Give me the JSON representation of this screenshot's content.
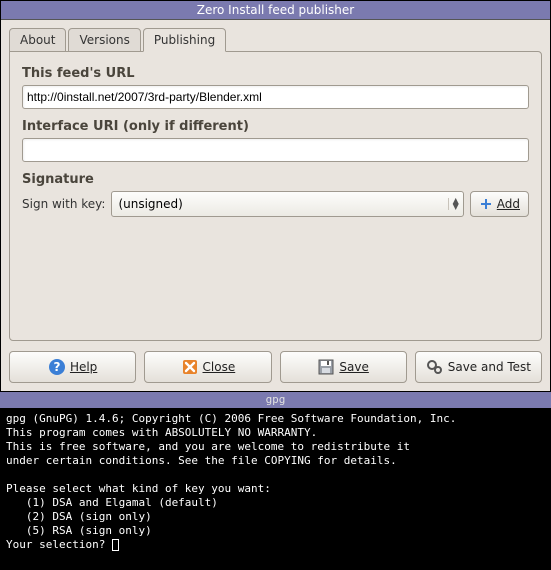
{
  "window": {
    "title": "Zero Install feed publisher"
  },
  "tabs": [
    {
      "label": "About"
    },
    {
      "label": "Versions"
    },
    {
      "label": "Publishing"
    }
  ],
  "feed_url": {
    "label": "This feed's URL",
    "value": "http://0install.net/2007/3rd-party/Blender.xml"
  },
  "interface_uri": {
    "label": "Interface URI (only if different)",
    "value": ""
  },
  "signature": {
    "label": "Signature",
    "sign_with_key_label": "Sign with key:",
    "selected": "(unsigned)",
    "add_label": "Add"
  },
  "buttons": {
    "help": "Help",
    "close": "Close",
    "save": "Save",
    "save_and_test": "Save and Test"
  },
  "terminal": {
    "title": "gpg",
    "lines": [
      "gpg (GnuPG) 1.4.6; Copyright (C) 2006 Free Software Foundation, Inc.",
      "This program comes with ABSOLUTELY NO WARRANTY.",
      "This is free software, and you are welcome to redistribute it",
      "under certain conditions. See the file COPYING for details.",
      "",
      "Please select what kind of key you want:",
      "   (1) DSA and Elgamal (default)",
      "   (2) DSA (sign only)",
      "   (5) RSA (sign only)",
      "Your selection? "
    ]
  }
}
